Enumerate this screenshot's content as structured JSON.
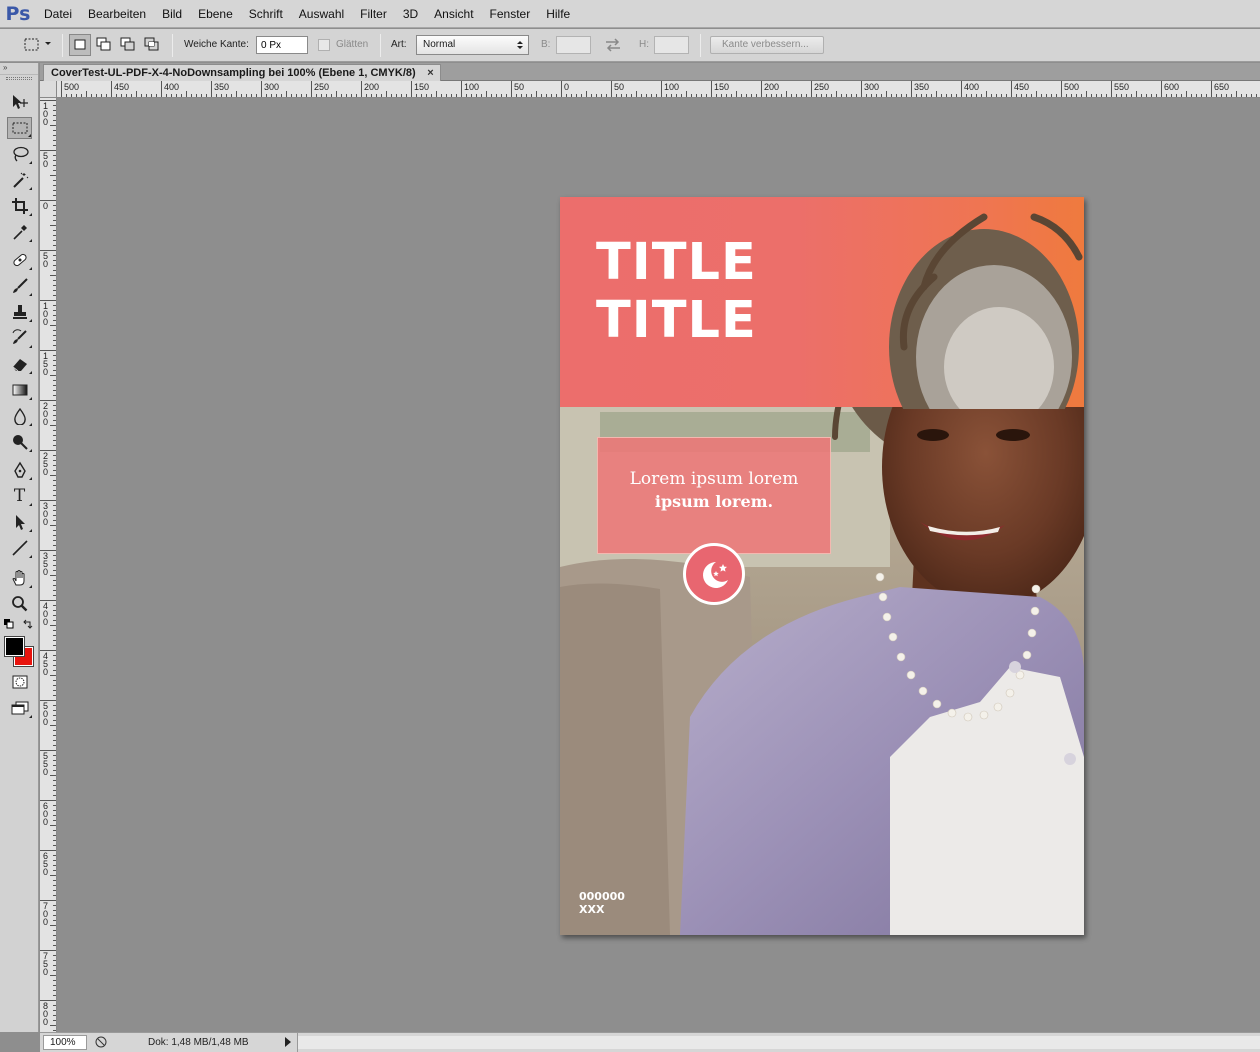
{
  "app": {
    "logo": "Ps"
  },
  "menu": [
    "Datei",
    "Bearbeiten",
    "Bild",
    "Ebene",
    "Schrift",
    "Auswahl",
    "Filter",
    "3D",
    "Ansicht",
    "Fenster",
    "Hilfe"
  ],
  "options": {
    "feather_label": "Weiche Kante:",
    "feather_value": "0 Px",
    "antialias_label": "Glätten",
    "style_label": "Art:",
    "style_value": "Normal",
    "width_label": "B:",
    "height_label": "H:",
    "refine_label": "Kante verbessern..."
  },
  "document": {
    "tab_title": "CoverTest-UL-PDF-X-4-NoDownsampling bei 100% (Ebene 1, CMYK/8)",
    "close_glyph": "×"
  },
  "ruler": {
    "h_labels": [
      "500",
      "450",
      "400",
      "350",
      "300",
      "250",
      "200",
      "150",
      "100",
      "50",
      "0",
      "50",
      "100",
      "150",
      "200",
      "250",
      "300",
      "350",
      "400",
      "450",
      "500",
      "550",
      "600",
      "650"
    ],
    "v_labels": [
      "100",
      "50",
      "0",
      "50",
      "100",
      "150",
      "200",
      "250",
      "300",
      "350",
      "400",
      "450",
      "500",
      "550",
      "600",
      "650",
      "700",
      "750",
      "800"
    ]
  },
  "cover": {
    "title_line1": "TITLE",
    "title_line2": "TITLE",
    "lorem_line1": "Lorem ipsum lorem",
    "lorem_line2": "ipsum lorem.",
    "code_line1": "000000",
    "code_line2": "XXX",
    "brand_color": "#ed6e6b",
    "badge_icon": "moon-stars-icon"
  },
  "status": {
    "zoom": "100%",
    "doc_size": "Dok: 1,48 MB/1,48 MB"
  },
  "tools": [
    "move-tool",
    "marquee-tool",
    "lasso-tool",
    "magic-wand-tool",
    "crop-tool",
    "eyedropper-tool",
    "healing-brush-tool",
    "brush-tool",
    "clone-stamp-tool",
    "history-brush-tool",
    "eraser-tool",
    "gradient-tool",
    "blur-tool",
    "dodge-tool",
    "pen-tool",
    "type-tool",
    "path-selection-tool",
    "line-tool",
    "hand-tool",
    "zoom-tool"
  ],
  "colors": {
    "foreground": "#000000",
    "background": "#e8140e"
  }
}
